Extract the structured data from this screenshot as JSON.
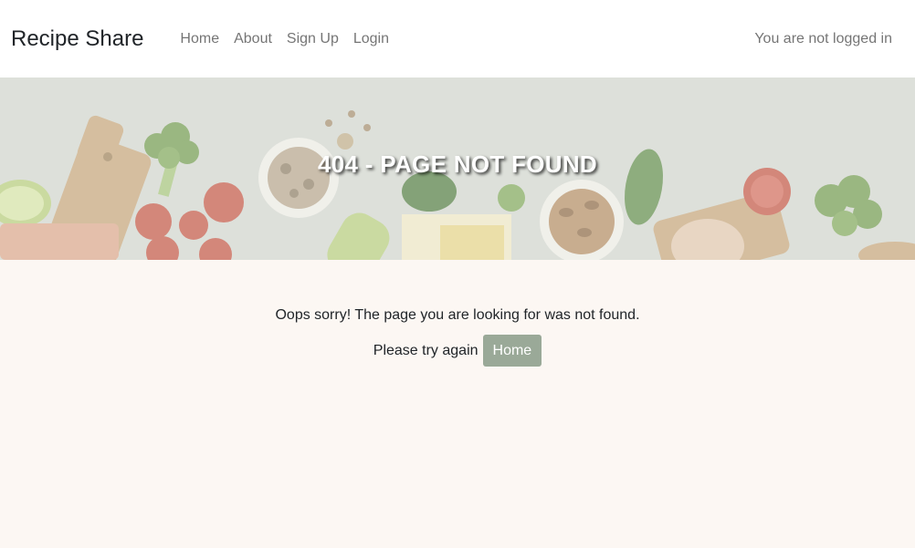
{
  "navbar": {
    "brand": "Recipe Share",
    "links": [
      "Home",
      "About",
      "Sign Up",
      "Login"
    ],
    "status": "You are not logged in"
  },
  "hero": {
    "title": "404 - PAGE NOT FOUND"
  },
  "main": {
    "message": "Oops sorry! The page you are looking for was not found.",
    "retry_text": "Please try again",
    "home_button": "Home"
  },
  "colors": {
    "page_background": "#fcf7f3",
    "navbar_background": "#ffffff",
    "button_background": "#9aa998",
    "nav_link_color": "#8c8c8c"
  }
}
